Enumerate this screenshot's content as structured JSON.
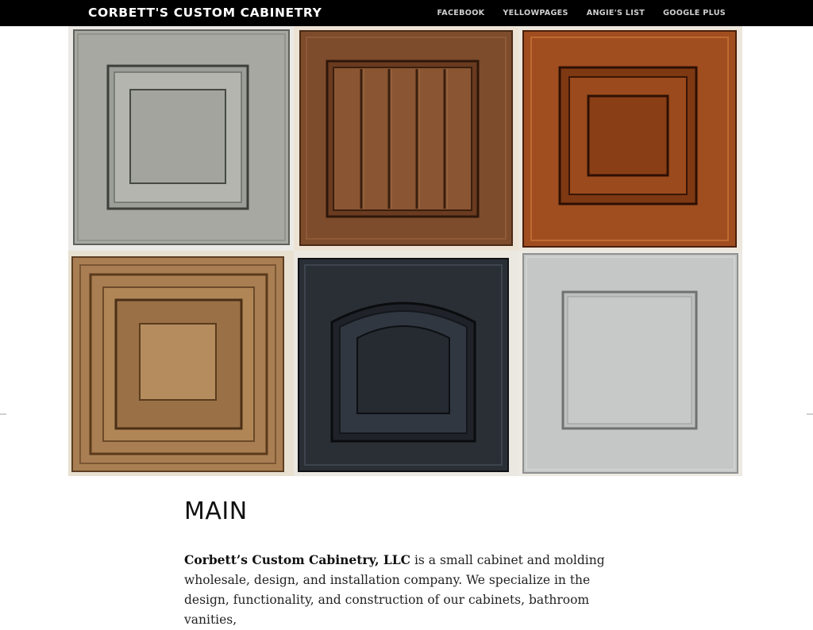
{
  "header": {
    "brand": "CORBETT'S CUSTOM CABINETRY",
    "nav": [
      {
        "label": "FACEBOOK"
      },
      {
        "label": "YELLOWPAGES"
      },
      {
        "label": "ANGIE'S LIST"
      },
      {
        "label": "GOOGLE PLUS"
      }
    ]
  },
  "hero": {
    "doors": [
      {
        "style": "raised-panel-gray",
        "color": "#a6a8a1"
      },
      {
        "style": "beadboard-wood",
        "color": "#7a4a2c"
      },
      {
        "style": "raised-panel-cherry",
        "color": "#9a4a1e"
      },
      {
        "style": "raised-panel-natural",
        "color": "#a97e52"
      },
      {
        "style": "arched-black",
        "color": "#2a2f36"
      },
      {
        "style": "shaker-light-gray",
        "color": "#c4c7c6"
      }
    ]
  },
  "main": {
    "heading": "MAIN",
    "intro_bold": "Corbett’s Custom Cabinetry, LLC",
    "intro_text": " is a small cabinet and molding wholesale, design, and installation company. We specialize in the design, functionality, and construction of our cabinets, bathroom vanities,"
  }
}
